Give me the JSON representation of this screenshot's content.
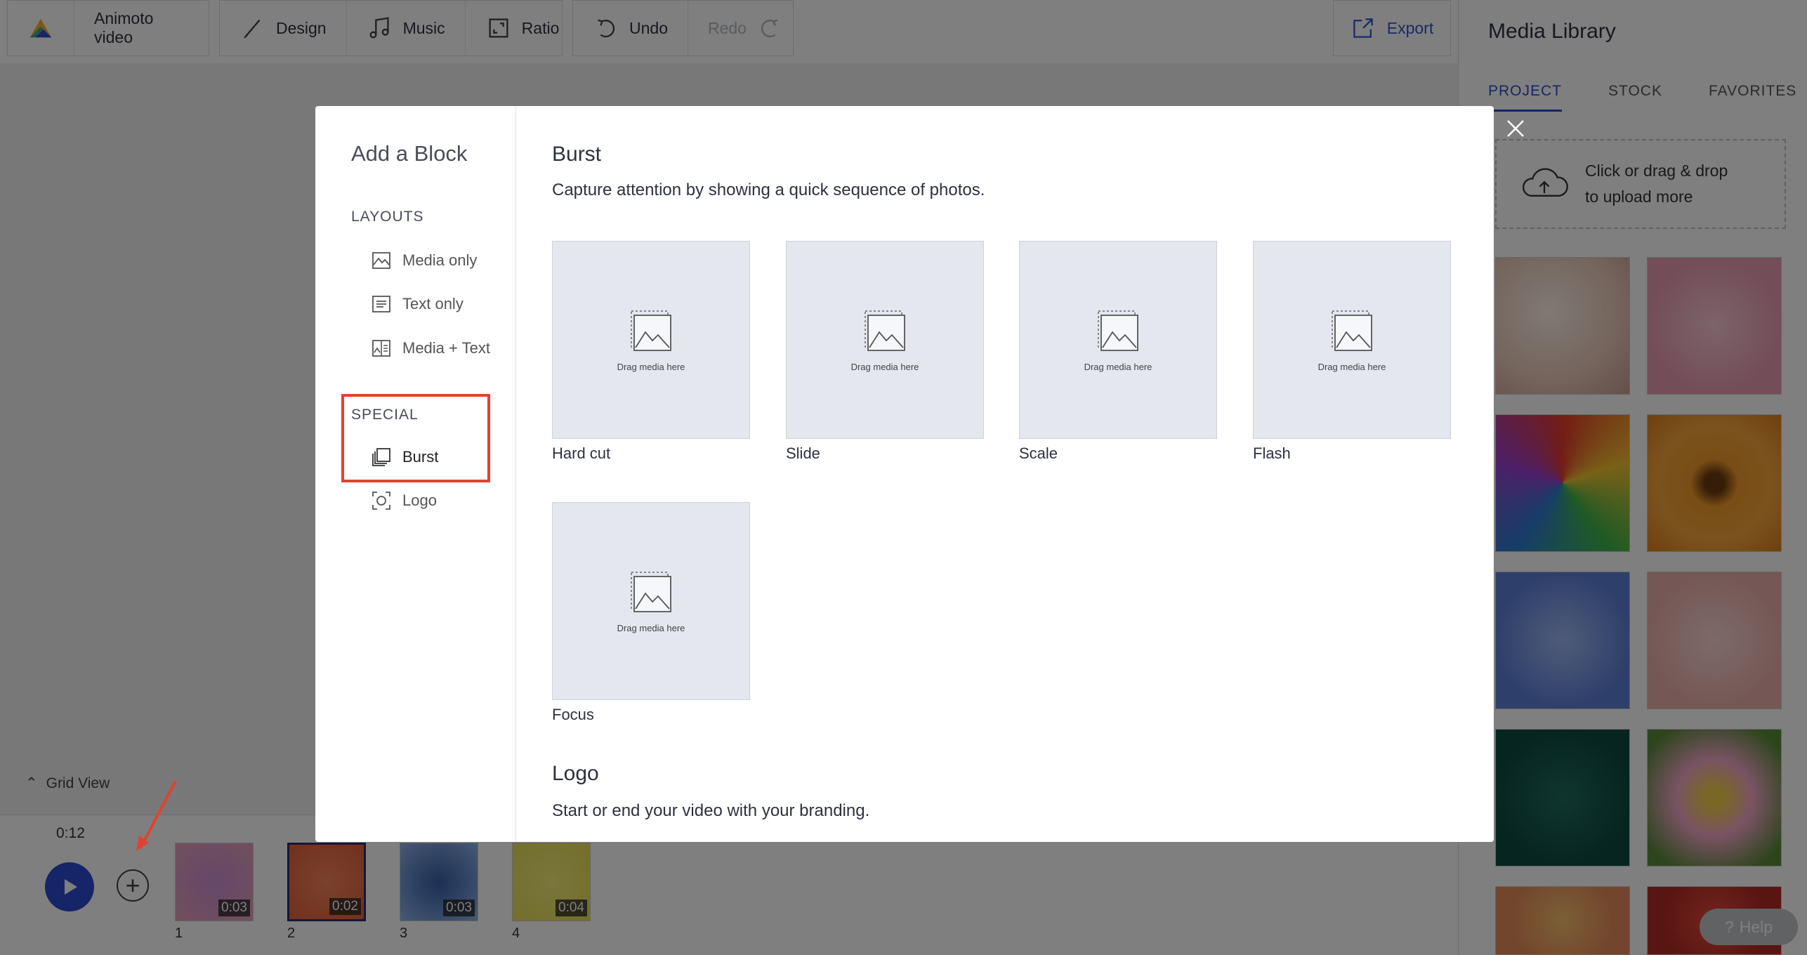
{
  "toolbar": {
    "project_name": "Animoto video",
    "design": "Design",
    "music": "Music",
    "ratio": "Ratio",
    "undo": "Undo",
    "redo": "Redo",
    "export": "Export"
  },
  "editor": {
    "grid_view": "Grid View",
    "time": "0:12",
    "thumbs": [
      {
        "num": "1",
        "dur": "0:03",
        "colors": [
          "#c98fd6",
          "#e4a0b7"
        ]
      },
      {
        "num": "2",
        "dur": "0:02",
        "colors": [
          "#f28559",
          "#e3603b"
        ]
      },
      {
        "num": "3",
        "dur": "0:03",
        "colors": [
          "#3a5ea8",
          "#8fb3e6"
        ]
      },
      {
        "num": "4",
        "dur": "0:04",
        "colors": [
          "#f4ec7a",
          "#e6dd55"
        ]
      }
    ]
  },
  "media_library": {
    "title": "Media Library",
    "tabs": [
      "PROJECT",
      "STOCK",
      "FAVORITES"
    ],
    "upload_line1": "Click or drag & drop",
    "upload_line2": "to upload more",
    "help": "Help"
  },
  "modal": {
    "title": "Add a Block",
    "layouts_header": "LAYOUTS",
    "layouts": [
      "Media only",
      "Text only",
      "Media + Text"
    ],
    "special_header": "SPECIAL",
    "special": [
      "Burst",
      "Logo"
    ],
    "burst": {
      "title": "Burst",
      "description": "Capture attention by showing a quick sequence of photos.",
      "drag_text": "Drag media here",
      "options": [
        "Hard cut",
        "Slide",
        "Scale",
        "Flash",
        "Focus"
      ]
    },
    "logo": {
      "title": "Logo",
      "description": "Start or end your video with your branding."
    }
  },
  "colors": {
    "accent": "#2d4ad0",
    "highlight": "#e0432f"
  }
}
